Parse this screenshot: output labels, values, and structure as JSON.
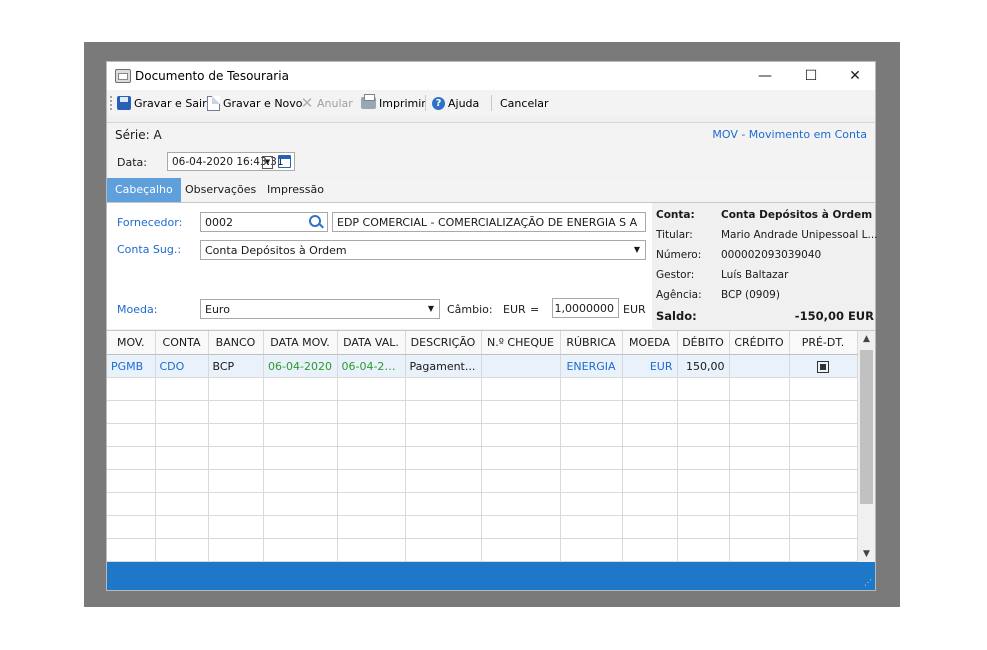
{
  "window": {
    "title": "Documento de Tesouraria",
    "minimize": "—",
    "maximize": "☐",
    "close": "✕"
  },
  "toolbar": {
    "save_exit": "Gravar e Sair",
    "save_new": "Gravar e Novo",
    "cancel_doc": "Anular",
    "print": "Imprimir",
    "help": "Ajuda",
    "cancel": "Cancelar"
  },
  "serie": {
    "label": "Série: A",
    "movement_type": "MOV - Movimento em Conta"
  },
  "date": {
    "label": "Data:",
    "value": "06-04-2020 16:43:31"
  },
  "tabs": [
    "Cabeçalho",
    "Observações",
    "Impressão"
  ],
  "form": {
    "supplier_label": "Fornecedor:",
    "supplier_code": "0002",
    "supplier_name": "EDP COMERCIAL - COMERCIALIZAÇÃO DE ENERGIA S A",
    "account_label": "Conta Sug.:",
    "account_value": "Conta Depósitos à Ordem",
    "currency_label": "Moeda:",
    "currency_value": "Euro",
    "exchange_label": "Câmbio:",
    "exchange_currency": "EUR",
    "exchange_equals": "=",
    "exchange_rate": "1,0000000",
    "exchange_base": "EUR"
  },
  "account_info": {
    "conta_k": "Conta:",
    "conta_v": "Conta Depósitos à Ordem",
    "titular_k": "Titular:",
    "titular_v": "Mario Andrade Unipessoal L...",
    "numero_k": "Número:",
    "numero_v": "000002093039040",
    "gestor_k": "Gestor:",
    "gestor_v": "Luís Baltazar",
    "agencia_k": "Agência:",
    "agencia_v": "BCP (0909)",
    "saldo_k": "Saldo:",
    "saldo_v": "-150,00 EUR"
  },
  "grid": {
    "columns": [
      "MOV.",
      "CONTA",
      "BANCO",
      "DATA MOV.",
      "DATA VAL.",
      "DESCRIÇÃO",
      "N.º CHEQUE",
      "RÚBRICA",
      "MOEDA",
      "DÉBITO",
      "CRÉDITO",
      "PRÉ-DT."
    ],
    "rows": [
      {
        "mov": "PGMB",
        "conta": "CDO",
        "banco": "BCP",
        "data_mov": "06-04-2020",
        "data_val": "06-04-20...",
        "descricao": "Pagament...",
        "cheque": "",
        "rubrica": "ENERGIA",
        "moeda": "EUR",
        "debito": "150,00",
        "credito": "",
        "pre_dt": true
      }
    ]
  },
  "colors": {
    "accent": "#1e6ad1",
    "green": "#2b9a2b",
    "tab_active": "#5e9fdc",
    "statusbar": "#1e78c8"
  }
}
